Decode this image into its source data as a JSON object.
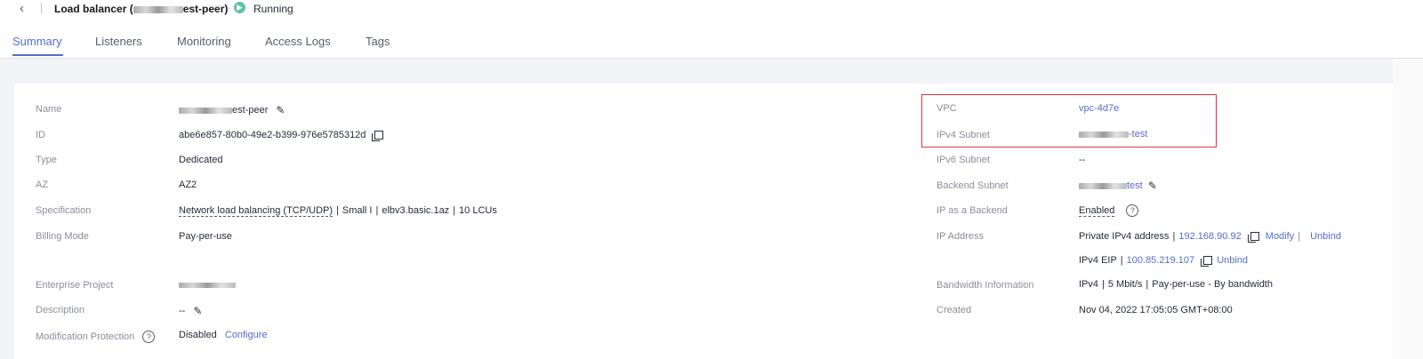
{
  "header": {
    "back_icon": "chevron-left-icon",
    "title_prefix": "Load balancer (",
    "title_suffix": "est-peer)",
    "status_label": "Running",
    "status_color": "#5dc4a4"
  },
  "tabs": [
    "Summary",
    "Listeners",
    "Monitoring",
    "Access Logs",
    "Tags"
  ],
  "left": {
    "name_label": "Name",
    "name_suffix": "est-peer",
    "id_label": "ID",
    "id_value": "abe6e857-80b0-49e2-b399-976e5785312d",
    "type_label": "Type",
    "type_value": "Dedicated",
    "az_label": "AZ",
    "az_value": "AZ2",
    "spec_label": "Specification",
    "spec_link": "Network load balancing (TCP/UDP)",
    "spec_size": "Small I",
    "spec_flavor": "elbv3.basic.1az",
    "spec_lcu": "10 LCUs",
    "billing_label": "Billing Mode",
    "billing_value": "Pay-per-use",
    "ep_label": "Enterprise Project",
    "desc_label": "Description",
    "desc_value": "--",
    "modprot_label": "Modification Protection",
    "modprot_value": "Disabled",
    "modprot_link": "Configure"
  },
  "right": {
    "vpc_label": "VPC",
    "vpc_value": "vpc-4d7e",
    "ipv4_subnet_label": "IPv4 Subnet",
    "ipv4_subnet_suffix": "-test",
    "ipv6_subnet_label": "IPv6 Subnet",
    "ipv6_subnet_value": "--",
    "backend_subnet_label": "Backend Subnet",
    "backend_subnet_suffix": "test",
    "ip_backend_label": "IP as a Backend",
    "ip_backend_value": "Enabled",
    "ip_address_label": "IP Address",
    "private_ipv4_label": "Private IPv4 address",
    "private_ipv4_value": "192.168.90.92",
    "modify_link": "Modify",
    "unbind_link": "Unbind",
    "eip_label": "IPv4 EIP",
    "eip_value": "100.85.219.107",
    "eip_unbind_link": "Unbind",
    "bw_label": "Bandwidth Information",
    "bw_proto": "IPv4",
    "bw_rate": "5 Mbit/s",
    "bw_billing": "Pay-per-use - By bandwidth",
    "created_label": "Created",
    "created_value": "Nov 04, 2022 17:05:05 GMT+08:00"
  },
  "colors": {
    "accent": "#526ecc",
    "highlight": "#e0333d"
  }
}
